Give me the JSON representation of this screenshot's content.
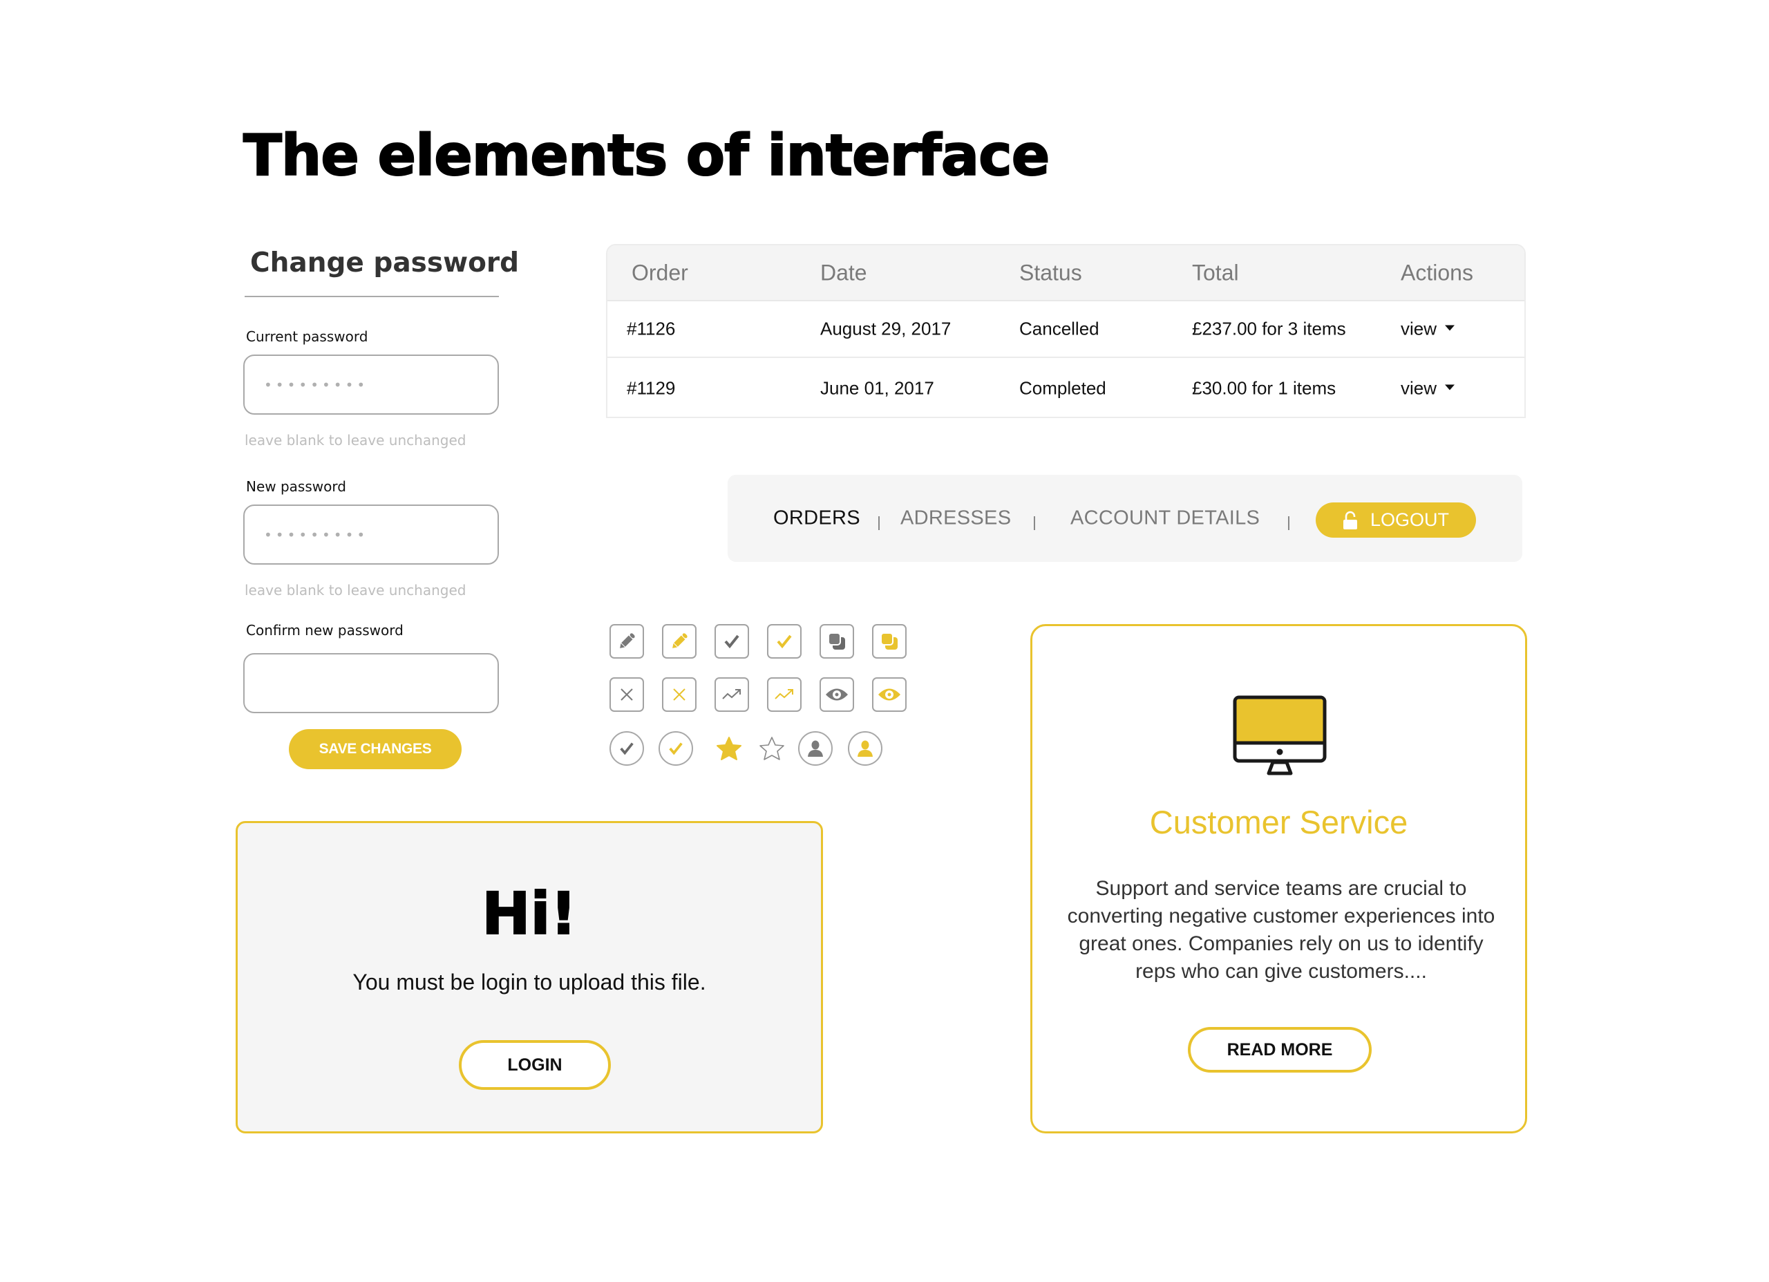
{
  "page": {
    "title": "The elements of interface"
  },
  "colors": {
    "accent": "#e9c32e",
    "gray_icon": "#7a7a7a",
    "border": "#a3a3a3",
    "panel_bg": "#f5f5f5"
  },
  "change_password": {
    "title": "Change password",
    "fields": [
      {
        "label": "Current password",
        "value": "•••••••••",
        "hint": "leave blank to leave unchanged"
      },
      {
        "label": "New password",
        "value": "•••••••••",
        "hint": "leave blank to leave unchanged"
      },
      {
        "label": "Confirm new password",
        "value": "",
        "hint": ""
      }
    ],
    "save_label": "SAVE CHANGES"
  },
  "orders_table": {
    "columns": [
      "Order",
      "Date",
      "Status",
      "Total",
      "Actions"
    ],
    "rows": [
      {
        "order": "#1126",
        "date": "August 29, 2017",
        "status": "Cancelled",
        "total": "£237.00 for 3 items",
        "action": "view"
      },
      {
        "order": "#1129",
        "date": "June 01, 2017",
        "status": "Completed",
        "total": "£30.00 for 1 items",
        "action": "view"
      }
    ]
  },
  "account_nav": {
    "items": [
      {
        "label": "ORDERS",
        "active": true
      },
      {
        "label": "ADRESSES",
        "active": false
      },
      {
        "label": "ACCOUNT DETAILS",
        "active": false
      }
    ],
    "separator": "|",
    "logout_label": "LOGOUT",
    "logout_icon": "lock-icon"
  },
  "icon_set": {
    "rows": [
      [
        {
          "icon": "pencil-icon",
          "style": "gray",
          "shape": "square"
        },
        {
          "icon": "pencil-icon",
          "style": "accent",
          "shape": "square"
        },
        {
          "icon": "check-icon",
          "style": "gray",
          "shape": "square"
        },
        {
          "icon": "check-icon",
          "style": "accent",
          "shape": "square"
        },
        {
          "icon": "copy-icon",
          "style": "gray",
          "shape": "square"
        },
        {
          "icon": "copy-icon",
          "style": "accent",
          "shape": "square"
        }
      ],
      [
        {
          "icon": "close-icon",
          "style": "gray",
          "shape": "square"
        },
        {
          "icon": "close-icon",
          "style": "accent",
          "shape": "square"
        },
        {
          "icon": "trending-up-icon",
          "style": "gray",
          "shape": "square"
        },
        {
          "icon": "trending-up-icon",
          "style": "accent",
          "shape": "square"
        },
        {
          "icon": "eye-icon",
          "style": "gray",
          "shape": "square"
        },
        {
          "icon": "eye-icon",
          "style": "accent",
          "shape": "square"
        }
      ],
      [
        {
          "icon": "check-icon",
          "style": "gray",
          "shape": "circle"
        },
        {
          "icon": "check-icon",
          "style": "accent",
          "shape": "circle"
        },
        {
          "icon": "star-filled-icon",
          "style": "accent",
          "shape": "none"
        },
        {
          "icon": "star-outline-icon",
          "style": "gray",
          "shape": "none"
        },
        {
          "icon": "user-icon",
          "style": "gray",
          "shape": "circle"
        },
        {
          "icon": "user-icon",
          "style": "accent",
          "shape": "circle"
        }
      ]
    ]
  },
  "login_card": {
    "title": "Hi!",
    "message": "You must be login to upload this file.",
    "button_label": "LOGIN"
  },
  "service_card": {
    "icon": "monitor-icon",
    "title": "Customer Service",
    "text": "Support and service teams are crucial to converting negative customer experiences into great ones. Companies rely on us to identify reps who can give customers....",
    "button_label": "READ MORE"
  }
}
